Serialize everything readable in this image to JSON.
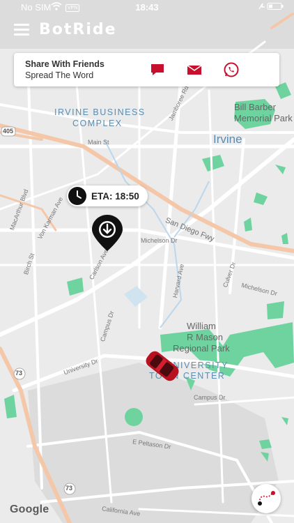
{
  "status_bar": {
    "carrier": "No SIM",
    "vpn": "VPN",
    "time": "18:43"
  },
  "app": {
    "logo": "BotRide"
  },
  "share_card": {
    "title": "Share With Friends",
    "subtitle": "Spread The Word",
    "icons": [
      "sms-icon",
      "email-icon",
      "whatsapp-icon"
    ],
    "accent_color": "#c8102e"
  },
  "eta": {
    "label": "ETA: 18:50"
  },
  "map": {
    "labels": {
      "irvine_business_1": "IRVINE BUSINESS",
      "irvine_business_2": "COMPLEX",
      "irvine": "Irvine",
      "bill_barber_1": "Bill Barber",
      "bill_barber_2": "Memorial Park",
      "william_1": "William",
      "william_2": "R Mason",
      "william_3": "Regional Park",
      "university_1": "UNIVERSITY",
      "university_2": "TOWN CENTER",
      "san_diego": "San Diego Fwy",
      "main_st": "Main St",
      "michelson": "Michelson Dr",
      "michelson_2": "Michelson Dr",
      "jamboree": "Jamboree Rd",
      "harvard": "Harvard Ave",
      "culver": "Culver Dr",
      "carlson": "Carlson Ave",
      "von_karman": "Von Karman Ave",
      "macarthur": "MacArthur Blvd",
      "birch": "Birch St",
      "campus": "Campus Dr",
      "campus_2": "Campus Dr",
      "university_dr": "University Dr",
      "peltason": "E Peltason Dr",
      "california": "California Ave",
      "fwy_405": "405",
      "fwy_73a": "73",
      "fwy_73b": "73"
    }
  },
  "attribution": {
    "google": "Google"
  }
}
